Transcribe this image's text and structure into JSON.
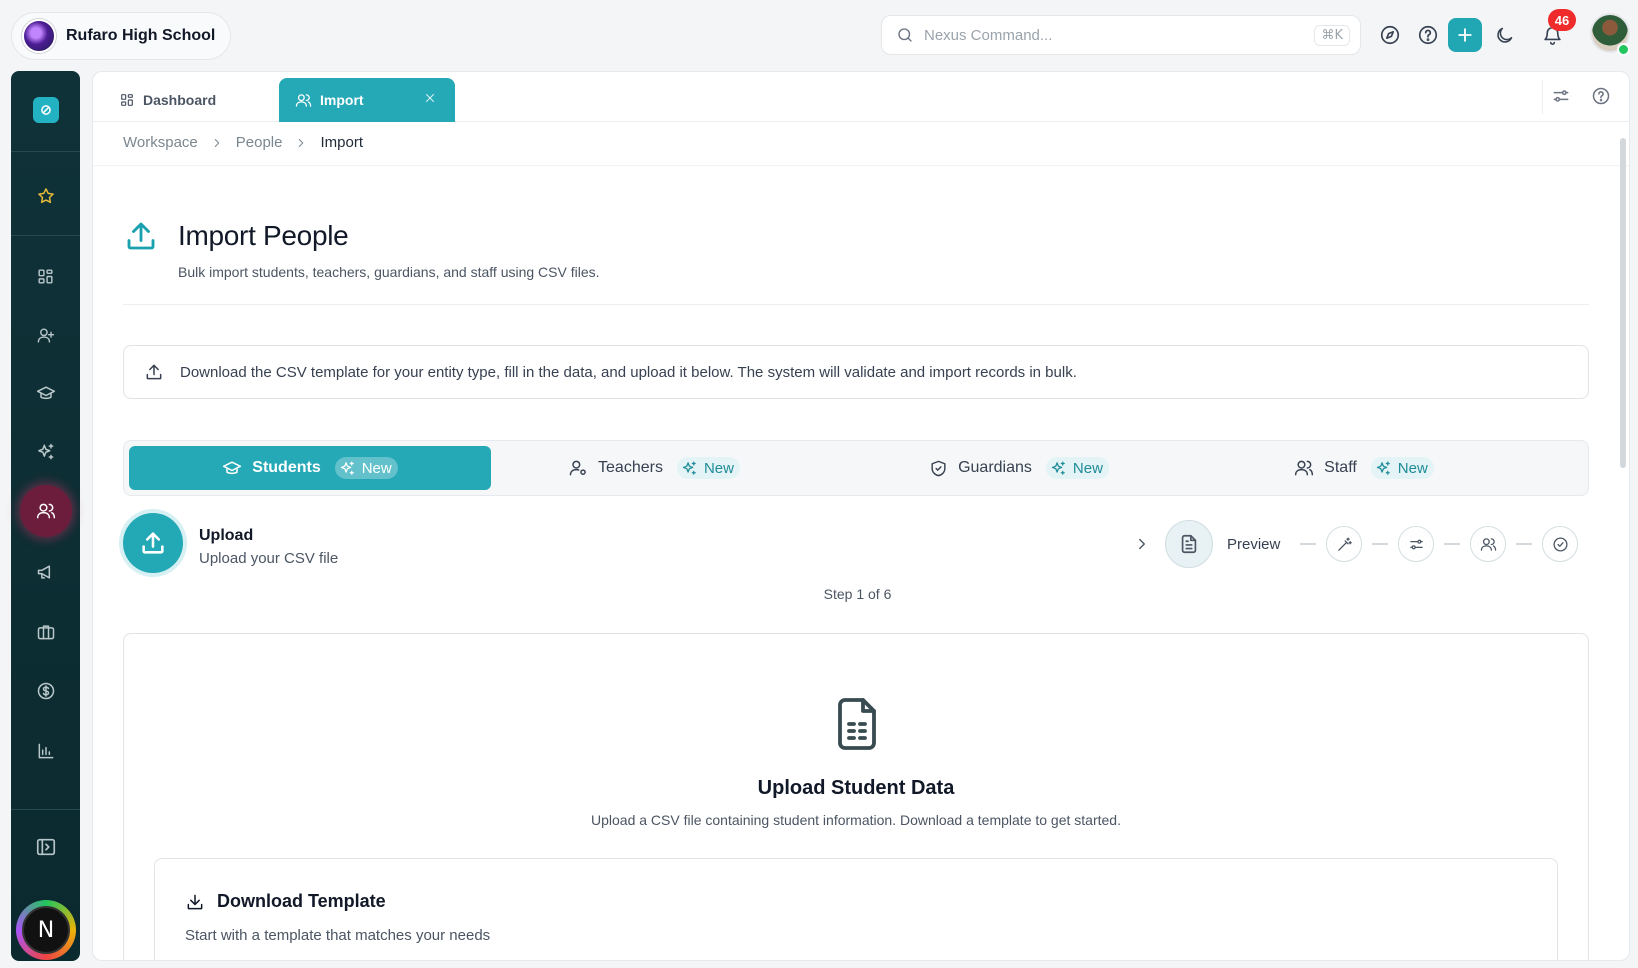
{
  "app": {
    "school_name": "Rufaro High School",
    "search_placeholder": "Nexus Command...",
    "search_shortcut": "⌘K",
    "notification_count": "46",
    "accent_color": "#26a9b7"
  },
  "sidebar": {
    "items": [
      {
        "name": "brand",
        "icon": "brand-icon"
      },
      {
        "name": "favorites",
        "icon": "star-icon"
      },
      {
        "name": "dashboard",
        "icon": "grid-icon"
      },
      {
        "name": "add-user",
        "icon": "user-plus-icon"
      },
      {
        "name": "academics",
        "icon": "graduation-cap-icon"
      },
      {
        "name": "ai",
        "icon": "sparkles-icon"
      },
      {
        "name": "people",
        "icon": "users-icon",
        "active": true
      },
      {
        "name": "announcements",
        "icon": "megaphone-icon"
      },
      {
        "name": "portfolio",
        "icon": "briefcase-icon"
      },
      {
        "name": "finance",
        "icon": "dollar-icon"
      },
      {
        "name": "reports",
        "icon": "bar-chart-icon"
      },
      {
        "name": "collapse",
        "icon": "panel-toggle-icon"
      }
    ],
    "user_initial": "N"
  },
  "tabs": [
    {
      "label": "Dashboard",
      "icon": "grid-icon"
    },
    {
      "label": "Import",
      "icon": "users-icon",
      "active": true
    }
  ],
  "breadcrumb": [
    "Workspace",
    "People",
    "Import"
  ],
  "page": {
    "title": "Import People",
    "subtitle": "Bulk import students, teachers, guardians, and staff using CSV files."
  },
  "info_banner": "Download the CSV template for your entity type, fill in the data, and upload it below. The system will validate and import records in bulk.",
  "entity_tabs": [
    {
      "label": "Students",
      "badge": "New",
      "icon": "graduation-cap-icon",
      "active": true
    },
    {
      "label": "Teachers",
      "badge": "New",
      "icon": "user-cog-icon"
    },
    {
      "label": "Guardians",
      "badge": "New",
      "icon": "shield-icon"
    },
    {
      "label": "Staff",
      "badge": "New",
      "icon": "users-icon"
    }
  ],
  "stepper": {
    "current_title": "Upload",
    "current_desc": "Upload your CSV file",
    "next_label": "Preview",
    "step_text": "Step 1 of 6"
  },
  "upload": {
    "title": "Upload Student Data",
    "subtitle": "Upload a CSV file containing student information. Download a template to get started.",
    "download_title": "Download Template",
    "download_subtitle": "Start with a template that matches your needs"
  }
}
